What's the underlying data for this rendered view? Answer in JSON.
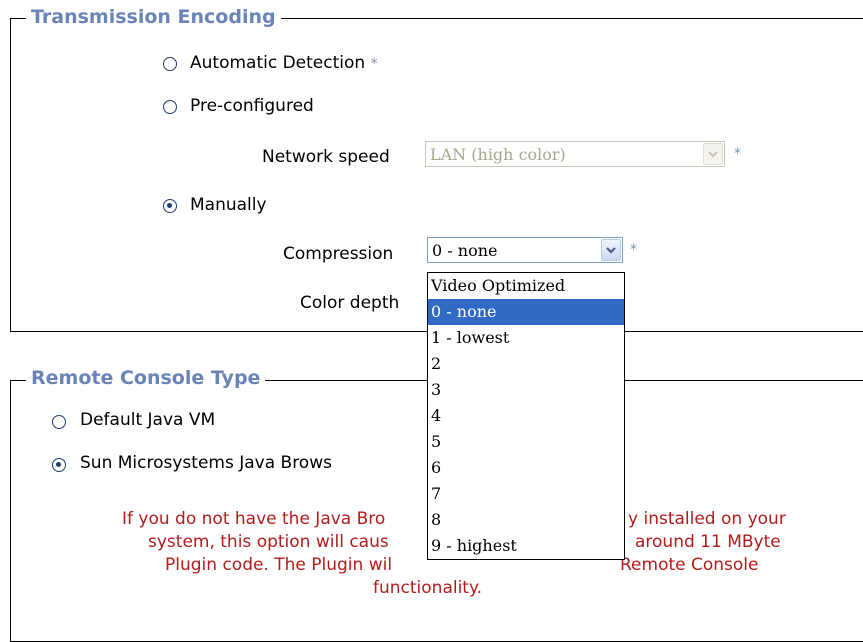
{
  "transmission": {
    "legend": "Transmission Encoding",
    "options": {
      "automatic": "Automatic Detection",
      "preconfigured": "Pre-configured",
      "manually": "Manually"
    },
    "selected": "manually",
    "network_speed": {
      "label": "Network speed",
      "value": "LAN (high color)",
      "disabled": true
    },
    "compression": {
      "label": "Compression",
      "value": "0 - none"
    },
    "color_depth": {
      "label": "Color depth"
    },
    "required_mark": "*"
  },
  "compression_dropdown": {
    "options": [
      "Video Optimized",
      "0 - none",
      "1 - lowest",
      "2",
      "3",
      "4",
      "5",
      "6",
      "7",
      "8",
      "9 - highest"
    ],
    "highlighted": "0 - none"
  },
  "remote_console": {
    "legend": "Remote Console Type",
    "options": {
      "default_java": "Default Java VM",
      "sun_java": "Sun Microsystems Java Brows"
    },
    "selected": "sun_java",
    "warning_lines": [
      "If you do not have the Java Bro",
      "y installed on your",
      "system, this option will caus",
      "around 11 MByte",
      "Plugin code. The Plugin wil",
      "Remote Console",
      "functionality."
    ]
  },
  "colors": {
    "legend": "#6b84b8",
    "warning": "#b21c1c",
    "highlight": "#316ac5",
    "radio": "#1c3d6e"
  },
  "icons": {
    "select_arrow": "chevron-down-icon",
    "radio": "radio-button-icon"
  }
}
